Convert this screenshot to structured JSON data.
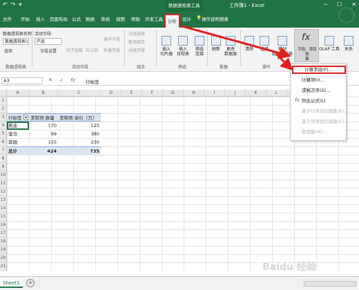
{
  "titlebar": {
    "undo": "↶",
    "redo": "↷",
    "qat_more": "▾",
    "context_tools": "数据透视表工具",
    "title": "工作簿1 - Excel",
    "min": "─",
    "max": "☐",
    "close": "✕"
  },
  "menu": {
    "tabs": [
      "文件",
      "开始",
      "插入",
      "页面布局",
      "公式",
      "数据",
      "审阅",
      "视图",
      "帮助",
      "开发工具",
      "分析",
      "设计"
    ],
    "active_index": 10,
    "tell_me": "操作说明搜索"
  },
  "ribbon": {
    "pt_name_label": "数据透视表名称:",
    "pt_name_value": "数据透视表1",
    "options_label": "选项",
    "active_field_label": "活动字段:",
    "active_field_value": "产品",
    "field_settings": "字段设置",
    "drill_down": "向下钻取",
    "drill_up": "向上钻",
    "expand_field": "展开字段",
    "collapse_field": "折叠字段",
    "group_selection": "分组选择",
    "ungroup": "取消组合",
    "group_field": "分组字段",
    "insert_slicer": "插入\n切片器",
    "insert_timeline": "插入\n日程表",
    "filter_connections": "筛选\n连接",
    "refresh": "刷新",
    "change_source": "更改\n数据源",
    "clear": "清除",
    "select": "选择",
    "move_pt": "移动\n数据透视表",
    "fields_items_sets": "字段、项目和\n集",
    "olap_tools": "OLAP 工具",
    "relationships": "关系",
    "groups": {
      "pivot": "数据透视表",
      "active_field": "活动字段",
      "group": "组合",
      "filter": "筛选",
      "data": "数据",
      "actions": "操作"
    }
  },
  "formula_bar": {
    "name_box": "A3",
    "cancel": "✕",
    "enter": "✓",
    "fx": "fx",
    "content": "行标签"
  },
  "columns": [
    "A",
    "B",
    "C",
    "D",
    "E",
    "F",
    "G",
    "H",
    "I",
    "J",
    "K",
    "L",
    "M",
    "N"
  ],
  "rows": [
    "1",
    "2",
    "3",
    "4",
    "5",
    "6",
    "7",
    "8",
    "9",
    "10",
    "11",
    "12",
    "13",
    "14",
    "15",
    "16",
    "17",
    "18",
    "19",
    "20",
    "21"
  ],
  "pivot": {
    "headers": [
      "行标签",
      "求和项:数量",
      "求和项:单价（万）"
    ],
    "filter_btn": "▾",
    "data": [
      [
        "奥迪",
        "170",
        "125"
      ],
      [
        "宝马",
        "99",
        "380"
      ],
      [
        "奔驰",
        "155",
        "230"
      ]
    ],
    "total": [
      "总计",
      "424",
      "735"
    ]
  },
  "dropdown": {
    "items": [
      "计算字段(F)...",
      "计算项(I)...",
      "求解次序(S)...",
      "列出公式(L)",
      "基于行项目创建集(R)...",
      "基于列项目创建集(C)...",
      "管理集(M)..."
    ],
    "dimmed": [
      false,
      false,
      false,
      false,
      true,
      true,
      true
    ],
    "highlight_index": 0,
    "fx_glyph": "fx"
  },
  "sheet": {
    "tab": "Sheet1",
    "add": "+"
  },
  "watermark": "Baidu 经验",
  "colors": {
    "excel_green": "#217346",
    "annotation_red": "#e02020",
    "pivot_header_bg": "#dce6f1"
  }
}
